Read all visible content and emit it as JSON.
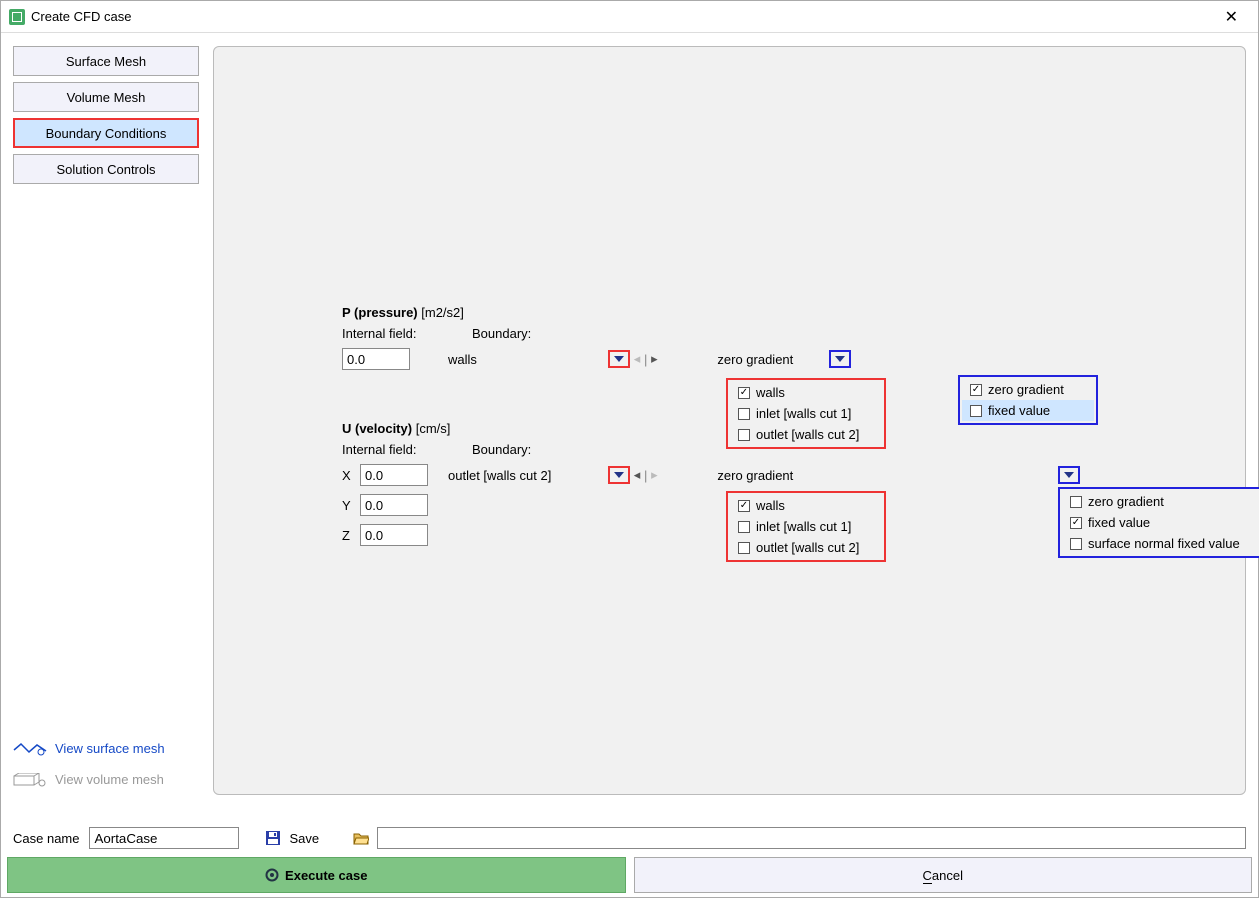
{
  "window": {
    "title": "Create CFD case"
  },
  "sidebar": {
    "tabs": [
      {
        "label": "Surface Mesh"
      },
      {
        "label": "Volume Mesh"
      },
      {
        "label": "Boundary Conditions"
      },
      {
        "label": "Solution Controls"
      }
    ],
    "view_surface": "View surface mesh",
    "view_volume": "View volume mesh"
  },
  "p": {
    "title_bold": "P (pressure)",
    "unit": "[m2/s2]",
    "internal_label": "Internal field:",
    "boundary_label": "Boundary:",
    "internal_value": "0.0",
    "selected_boundary": "walls",
    "bc_label": "zero gradient",
    "boundaries": [
      {
        "label": "walls",
        "checked": true
      },
      {
        "label": "inlet [walls cut 1]",
        "checked": false
      },
      {
        "label": "outlet [walls cut 2]",
        "checked": false
      }
    ],
    "bc_options": [
      {
        "label": "zero gradient",
        "checked": true
      },
      {
        "label": "fixed value",
        "checked": false,
        "hover": true
      }
    ]
  },
  "u": {
    "title_bold": "U (velocity)",
    "unit": "[cm/s]",
    "internal_label": "Internal field:",
    "boundary_label": "Boundary:",
    "axes": [
      {
        "axis": "X",
        "value": "0.0"
      },
      {
        "axis": "Y",
        "value": "0.0"
      },
      {
        "axis": "Z",
        "value": "0.0"
      }
    ],
    "selected_boundary": "outlet [walls cut 2]",
    "bc_label": "zero gradient",
    "boundaries": [
      {
        "label": "walls",
        "checked": true
      },
      {
        "label": "inlet [walls cut 1]",
        "checked": false
      },
      {
        "label": "outlet [walls cut 2]",
        "checked": false
      }
    ],
    "bc_options": [
      {
        "label": "zero gradient",
        "checked": false
      },
      {
        "label": "fixed value",
        "checked": true
      },
      {
        "label": "surface normal fixed value",
        "checked": false
      }
    ]
  },
  "bottom": {
    "case_label": "Case name",
    "case_name": "AortaCase",
    "save_label": "Save",
    "execute": "Execute case",
    "cancel": "Cancel"
  }
}
